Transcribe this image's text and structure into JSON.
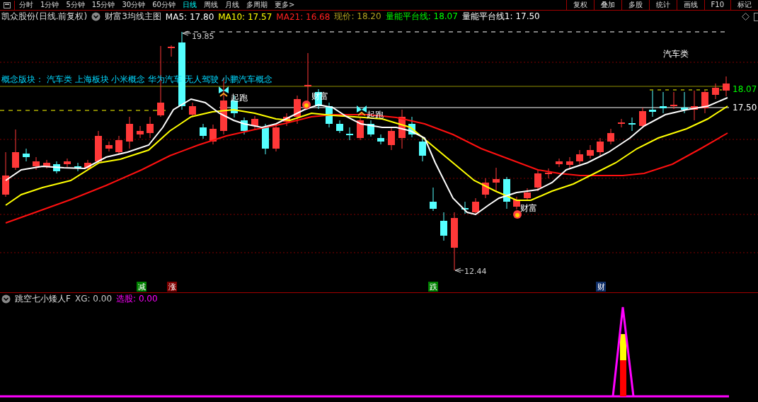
{
  "toolbar": {
    "periods": [
      {
        "label": "分时",
        "selected": false
      },
      {
        "label": "1分钟",
        "selected": false
      },
      {
        "label": "5分钟",
        "selected": false
      },
      {
        "label": "15分钟",
        "selected": false
      },
      {
        "label": "30分钟",
        "selected": false
      },
      {
        "label": "60分钟",
        "selected": false
      },
      {
        "label": "日线",
        "selected": true
      },
      {
        "label": "周线",
        "selected": false
      },
      {
        "label": "月线",
        "selected": false
      },
      {
        "label": "多周期",
        "selected": false
      },
      {
        "label": "更多>",
        "selected": false
      }
    ],
    "tools": [
      "复权",
      "叠加",
      "多股",
      "统计",
      "画线",
      "F10",
      "标记"
    ]
  },
  "header": {
    "stock": "凯众股份(日线.前复权)",
    "indicator": "财富3均线主图",
    "values": [
      {
        "label": "MA5:",
        "value": "17.80",
        "color": "#ffffff"
      },
      {
        "label": "MA10:",
        "value": "17.57",
        "color": "#ffff00"
      },
      {
        "label": "MA21:",
        "value": "16.68",
        "color": "#ff2020"
      },
      {
        "label": "现价:",
        "value": "18.20",
        "color": "#b0a020"
      },
      {
        "label": "量能平台线:",
        "value": "18.07",
        "color": "#00ff00"
      },
      {
        "label": "量能平台线1:",
        "value": "17.50",
        "color": "#ffffff"
      }
    ]
  },
  "chart": {
    "concepts": "概念版块：  汽车类 上海板块 小米概念 华为汽车 无人驾驶 小鹏汽车概念",
    "high": "19.85",
    "low": "12.44",
    "sector": "汽车类",
    "levels": [
      {
        "label": "18.07",
        "color": "#00ff00"
      },
      {
        "label": "17.50",
        "color": "#ffffff"
      }
    ],
    "signals": [
      {
        "kind": "start",
        "label": "起跑"
      },
      {
        "kind": "wealth",
        "label": "财富"
      },
      {
        "kind": "start",
        "label": "起跑"
      },
      {
        "kind": "wealth",
        "label": "财富"
      }
    ],
    "markers": [
      {
        "label": "减",
        "color": "#008000"
      },
      {
        "label": "涨",
        "color": "#800000"
      },
      {
        "label": "跌",
        "color": "#008000"
      },
      {
        "label": "财",
        "color": "#10306a"
      }
    ]
  },
  "lower": {
    "title": "跳空七小矮人F",
    "values": [
      {
        "label": "XG:",
        "value": "0.00",
        "color": "#c8c8c8"
      },
      {
        "label": "选股:",
        "value": "0.00",
        "color": "#ff00ff"
      }
    ]
  }
}
